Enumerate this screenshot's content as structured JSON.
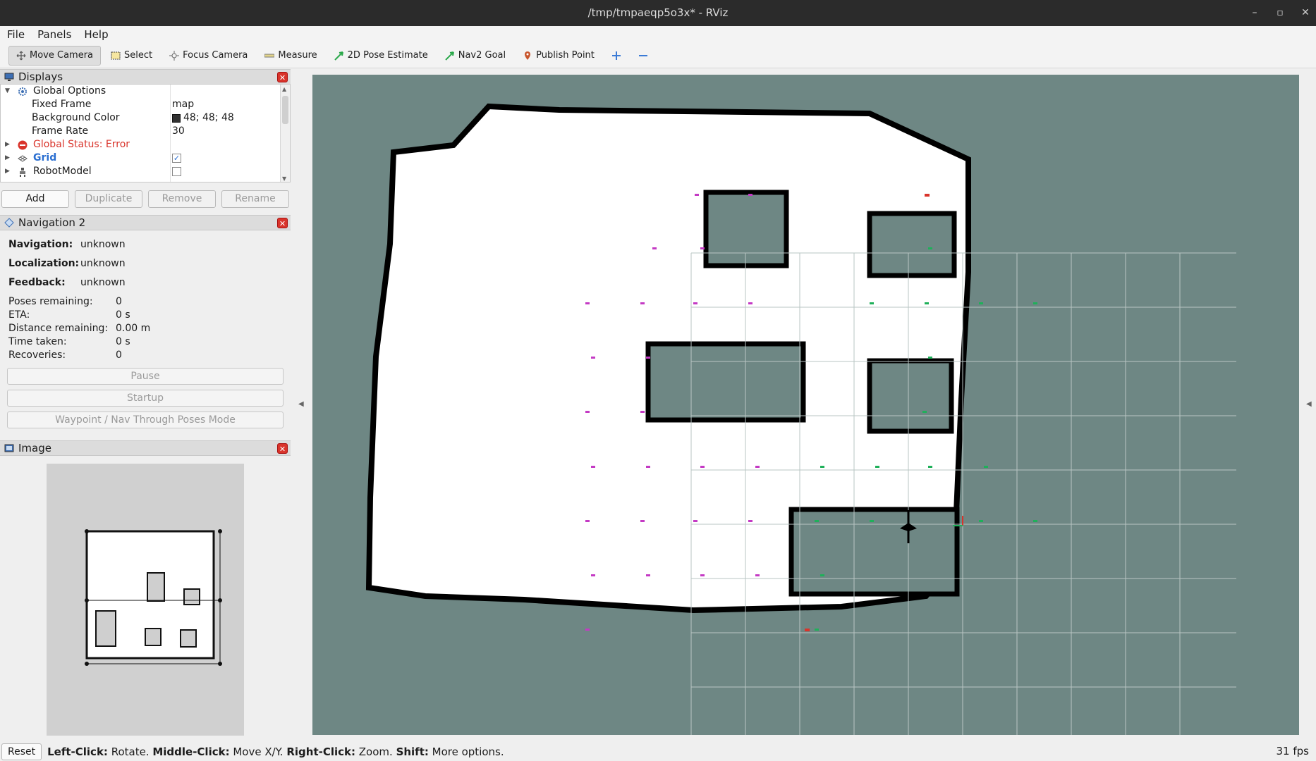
{
  "window": {
    "title": "/tmp/tmpaeqp5o3x* - RViz"
  },
  "menu": {
    "file": "File",
    "panels": "Panels",
    "help": "Help"
  },
  "toolbar": {
    "move_camera": "Move Camera",
    "select": "Select",
    "focus_camera": "Focus Camera",
    "measure": "Measure",
    "pose_estimate": "2D Pose Estimate",
    "nav2_goal": "Nav2 Goal",
    "publish_point": "Publish Point"
  },
  "displays": {
    "title": "Displays",
    "rows": {
      "global_options": "Global Options",
      "fixed_frame_label": "Fixed Frame",
      "fixed_frame_value": "map",
      "bg_color_label": "Background Color",
      "bg_color_value": "48; 48; 48",
      "frame_rate_label": "Frame Rate",
      "frame_rate_value": "30",
      "global_status": "Global Status: Error",
      "grid": "Grid",
      "robot_model": "RobotModel"
    },
    "grid_checked": true,
    "robot_model_checked": false,
    "buttons": {
      "add": "Add",
      "duplicate": "Duplicate",
      "remove": "Remove",
      "rename": "Rename"
    }
  },
  "navigation": {
    "title": "Navigation 2",
    "navigation_label": "Navigation:",
    "navigation_value": "unknown",
    "localization_label": "Localization:",
    "localization_value": "unknown",
    "feedback_label": "Feedback:",
    "feedback_value": "unknown",
    "poses_remaining_label": "Poses remaining:",
    "poses_remaining_value": "0",
    "eta_label": "ETA:",
    "eta_value": "0 s",
    "distance_label": "Distance remaining:",
    "distance_value": "0.00 m",
    "time_label": "Time taken:",
    "time_value": "0 s",
    "recoveries_label": "Recoveries:",
    "recoveries_value": "0",
    "pause": "Pause",
    "startup": "Startup",
    "waypoint_mode": "Waypoint / Nav Through Poses Mode"
  },
  "image_panel": {
    "title": "Image"
  },
  "status": {
    "reset": "Reset",
    "lc_key": "Left-Click:",
    "lc_text": " Rotate. ",
    "mc_key": "Middle-Click:",
    "mc_text": " Move X/Y. ",
    "rc_key": "Right-Click:",
    "rc_text": " Zoom. ",
    "shift_key": "Shift:",
    "shift_text": " More options.",
    "fps": "31 fps"
  },
  "colors": {
    "map_free": "#ffffff",
    "map_unknown": "#6e8784",
    "map_occupied": "#000000",
    "pose_magenta": "#c43ac4",
    "pose_green": "#1fb05a",
    "error_red": "#d9342b"
  }
}
